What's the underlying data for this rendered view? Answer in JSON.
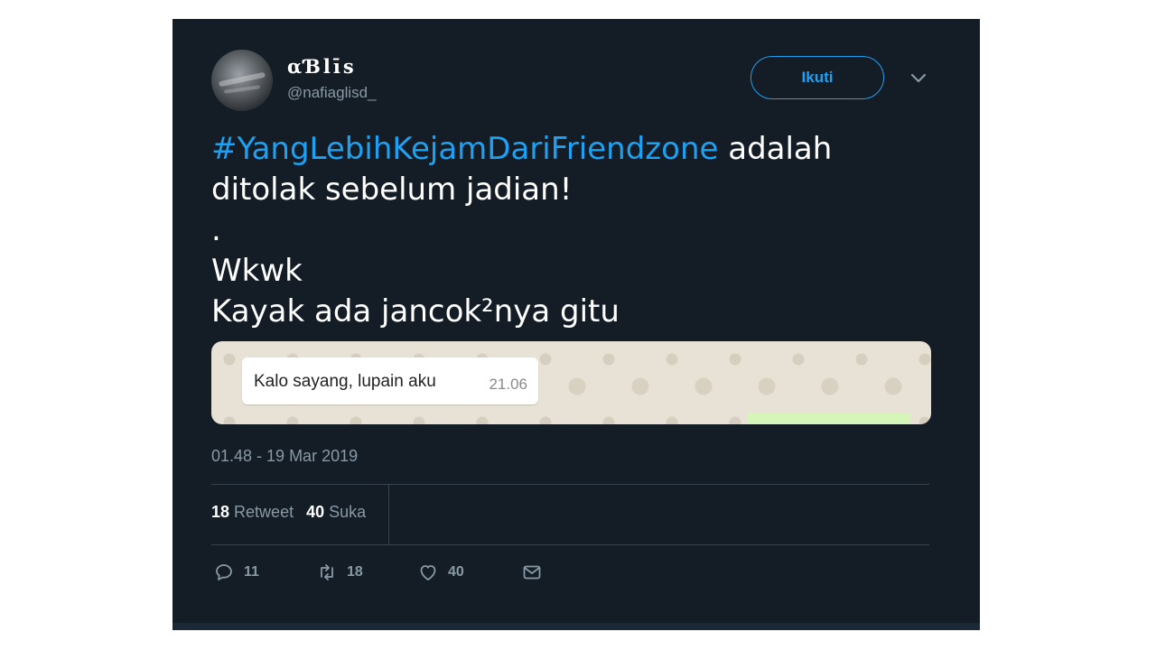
{
  "user": {
    "display_name": "αƁlīs",
    "handle": "@nafiaglisd_"
  },
  "follow_button": "Ikuti",
  "tweet": {
    "hashtag": "#YangLebihKejamDariFriendzone",
    "line1_rest": " adalah",
    "line2": "ditolak sebelum jadian!",
    "line3": ".",
    "line4": "Wkwk",
    "line5": "Kayak ada jancok²nya gitu"
  },
  "media": {
    "message": "Kalo sayang, lupain aku",
    "message_time": "21.06"
  },
  "timestamp": "01.48 - 19 Mar 2019",
  "stats": {
    "retweets_count": "18",
    "retweets_label": "Retweet",
    "likes_count": "40",
    "likes_label": "Suka"
  },
  "actions": {
    "reply_count": "11",
    "retweet_count": "18",
    "like_count": "40"
  },
  "icons": [
    "chevron-down-icon",
    "reply-icon",
    "retweet-icon",
    "heart-icon",
    "mail-icon"
  ],
  "colors": {
    "background": "#141d26",
    "accent": "#1da1f2",
    "muted": "#8899a6"
  }
}
